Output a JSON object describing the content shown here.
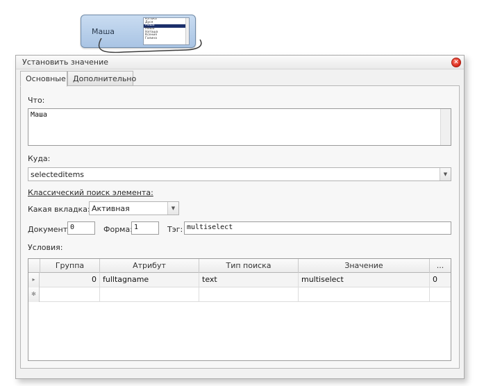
{
  "node": {
    "label": "Маша",
    "list_items": [
      "Катька",
      "Дуся",
      "Маша",
      "Маша",
      "Наташа",
      "Ксения",
      "Галина"
    ],
    "selected_index": 2
  },
  "dialog": {
    "title": "Установить значение",
    "close_icon": "close-icon",
    "tabs": [
      {
        "label": "Основные",
        "active": true
      },
      {
        "label": "Дополнительно",
        "active": false
      }
    ],
    "what_label": "Что:",
    "what_value": "Маша",
    "where_label": "Куда:",
    "where_value": "selecteditems",
    "classic_search_label": "Классический поиск элемента:",
    "tab_label": "Какая вкладка:",
    "tab_value": "Активная",
    "document_label": "Документ:",
    "document_value": "0",
    "form_label": "Форма:",
    "form_value": "1",
    "tag_label": "Тэг:",
    "tag_value": "multiselect",
    "conditions_label": "Условия:",
    "grid": {
      "columns": [
        "Группа",
        "Атрибут",
        "Тип поиска",
        "Значение",
        "..."
      ],
      "rows": [
        {
          "indicator": "▸",
          "group": "0",
          "attribute": "fulltagname",
          "search_type": "text",
          "value": "multiselect",
          "extra": "0"
        },
        {
          "indicator": "✻",
          "group": "",
          "attribute": "",
          "search_type": "",
          "value": "",
          "extra": ""
        }
      ]
    },
    "colors": {
      "accent_close": "#d8281a",
      "selected_list": "#1b2f6b",
      "node_fill": "#b9d0ea"
    }
  }
}
